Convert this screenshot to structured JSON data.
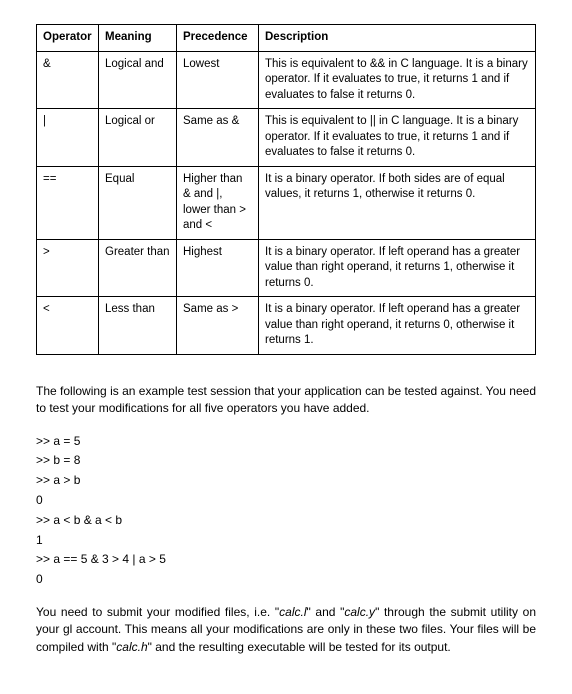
{
  "table": {
    "headers": {
      "operator": "Operator",
      "meaning": "Meaning",
      "precedence": "Precedence",
      "description": "Description"
    },
    "rows": [
      {
        "operator": "&",
        "meaning": "Logical and",
        "precedence": "Lowest",
        "description": "This is equivalent to && in C language. It is a binary operator. If it evaluates to true, it returns 1 and if evaluates to false it returns 0."
      },
      {
        "operator": "|",
        "meaning": "Logical or",
        "precedence": "Same as &",
        "description": "This is equivalent to || in C language. It is a binary operator. If it evaluates to true, it returns 1 and if evaluates to false it returns 0."
      },
      {
        "operator": "==",
        "meaning": "Equal",
        "precedence": "Higher than & and |, lower than > and <",
        "description": "It is a binary operator. If both sides are of equal values, it returns 1, otherwise it returns 0."
      },
      {
        "operator": ">",
        "meaning": "Greater than",
        "precedence": "Highest",
        "description": "It is a binary operator. If left operand has a greater value than right operand, it returns 1, otherwise it returns 0."
      },
      {
        "operator": "<",
        "meaning": "Less than",
        "precedence": "Same as >",
        "description": "It is a binary operator. If left operand has a greater value than right operand, it returns 0, otherwise it returns 1."
      }
    ]
  },
  "intro_para": "The following is an example test session that your application can be tested against. You need to test your modifications for all five operators you have added.",
  "session": [
    ">> a = 5",
    ">> b = 8",
    ">> a > b",
    "0",
    ">> a < b & a < b",
    "1",
    ">> a == 5 & 3 > 4 | a > 5",
    "0"
  ],
  "outro": {
    "t1": "You need to submit your modified files, i.e. \"",
    "f1": "calc.l",
    "t2": "\" and \"",
    "f2": "calc.y",
    "t3": "\" through the submit utility on your gl account. This means all your modifications are only in these two files. Your files will be compiled with \"",
    "f3": "calc.h",
    "t4": "\" and the resulting executable will be tested for its output."
  }
}
